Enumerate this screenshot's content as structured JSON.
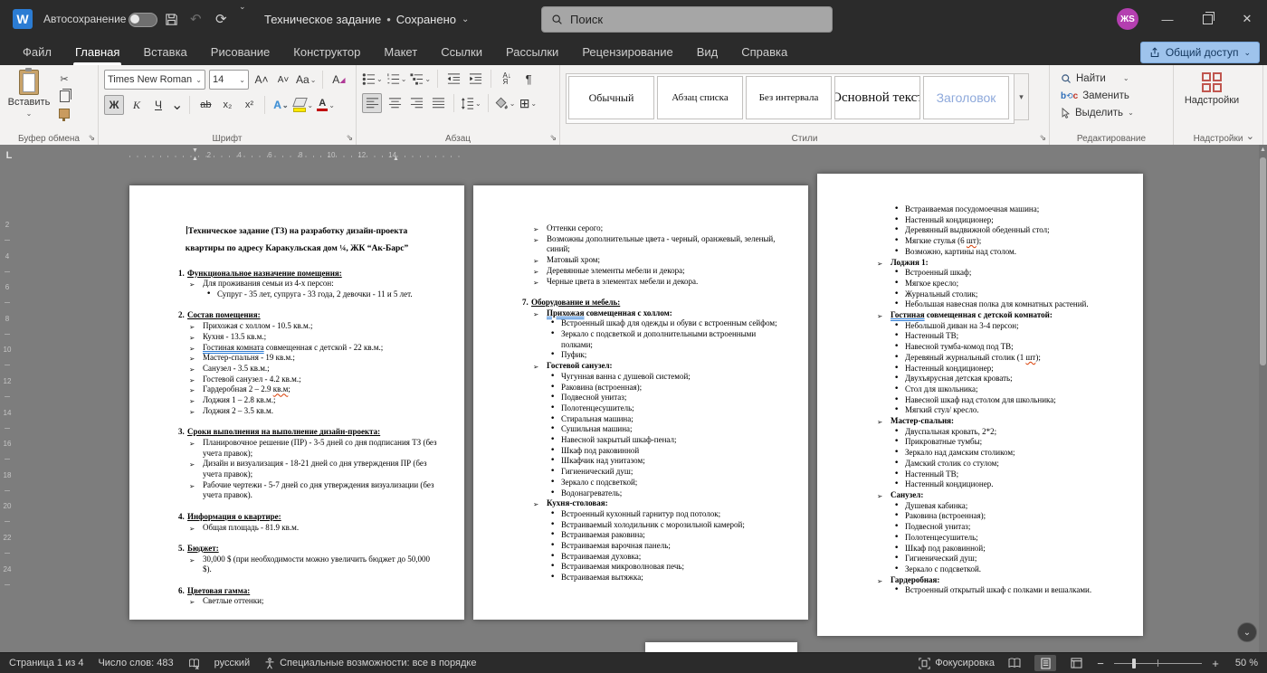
{
  "titlebar": {
    "autosave_label": "Автосохранение",
    "doc_title": "Техническое задание",
    "saved_status": "Сохранено",
    "search_placeholder": "Поиск",
    "avatar_initials": "ЖS",
    "share_label": "Общий доступ"
  },
  "icons": {
    "bullet_l1": "➢",
    "bullet_l2": "•",
    "undo": "↶",
    "redo": "⟳",
    "close": "✕",
    "minimize": "—",
    "borders": "⊞",
    "pilcrow": "¶"
  },
  "tabs": [
    {
      "id": "file",
      "label": "Файл"
    },
    {
      "id": "home",
      "label": "Главная",
      "active": true
    },
    {
      "id": "insert",
      "label": "Вставка"
    },
    {
      "id": "draw",
      "label": "Рисование"
    },
    {
      "id": "design",
      "label": "Конструктор"
    },
    {
      "id": "layout",
      "label": "Макет"
    },
    {
      "id": "references",
      "label": "Ссылки"
    },
    {
      "id": "mailings",
      "label": "Рассылки"
    },
    {
      "id": "review",
      "label": "Рецензирование"
    },
    {
      "id": "view",
      "label": "Вид"
    },
    {
      "id": "help",
      "label": "Справка"
    }
  ],
  "ribbon": {
    "clipboard": {
      "paste_label": "Вставить",
      "group_label": "Буфер обмена"
    },
    "font": {
      "font_name": "Times New Roman",
      "font_size": "14",
      "group_label": "Шрифт",
      "glyphs": {
        "bold": "Ж",
        "italic": "K",
        "underline": "Ч",
        "strikethrough": "ab",
        "subscript": "x₂",
        "superscript": "x²",
        "case": "Aa",
        "effects": "A",
        "color": "А",
        "grow": "A˄",
        "shrink": "A˅"
      }
    },
    "paragraph": {
      "group_label": "Абзац"
    },
    "styles": {
      "group_label": "Стили",
      "items": [
        {
          "id": "normal",
          "label": "Обычный"
        },
        {
          "id": "list-paragraph",
          "label": "Абзац списка"
        },
        {
          "id": "no-spacing",
          "label": "Без интервала"
        },
        {
          "id": "body-text",
          "label": "Основной текст"
        },
        {
          "id": "heading",
          "label": "Заголовок"
        }
      ]
    },
    "editing": {
      "find": "Найти",
      "replace": "Заменить",
      "select": "Выделить",
      "group_label": "Редактирование"
    },
    "addins": {
      "button_label": "Надстройки",
      "group_label": "Надстройки"
    }
  },
  "ruler": {
    "h_numbers": [
      "2",
      "4",
      "6",
      "8",
      "10",
      "12",
      "14"
    ],
    "v_numbers": [
      "2",
      "4",
      "6",
      "8",
      "10",
      "12",
      "14",
      "16",
      "18",
      "20",
      "22",
      "24"
    ]
  },
  "statusbar": {
    "page_info": "Страница 1 из 4",
    "word_count": "Число слов: 483",
    "language": "русский",
    "accessibility": "Специальные возможности: все в порядке",
    "focus_label": "Фокусировка",
    "zoom_level": "50 %"
  },
  "colors": {
    "titlebar": "#2b2b2b",
    "ribbon": "#f3f2f1",
    "canvas": "#7d7d7d",
    "accent_share": "#9ec3ec",
    "avatar": "#b43fb0",
    "addins_icon": "#c0564f",
    "heading_style": "#8ea9db",
    "spell_error": "#d83b01",
    "grammar_error": "#2d7cd6"
  },
  "pages": [
    {
      "blocks": [
        {
          "t": "title",
          "caret": true,
          "text": "Техническое задание (ТЗ) на разработку дизайн-проекта квартиры по адресу Каракульская дом ¼, ЖК “Ак-Барс”"
        },
        {
          "t": "gap"
        },
        {
          "t": "h",
          "num": "1.",
          "text": "Функциональное назначение помещения:"
        },
        {
          "t": "l1",
          "text": "Для проживания семьи из 4-х персон:"
        },
        {
          "t": "l2",
          "text": "Супруг - 35 лет, супруга - 33 года, 2 девочки - 11 и 5 лет."
        },
        {
          "t": "gap"
        },
        {
          "t": "h",
          "num": "2.",
          "text": "Состав помещения:"
        },
        {
          "t": "l1",
          "text": "Прихожая с холлом - 10.5 кв.м.;"
        },
        {
          "t": "l1",
          "text": "Кухня - 13.5 кв.м.;"
        },
        {
          "t": "l1",
          "parts": [
            {
              "x": "Гостиная комната",
              "m": "u-blue"
            },
            {
              "x": " совмещенная с детской - 22 кв.м.;"
            }
          ]
        },
        {
          "t": "l1",
          "text": "Мастер-спальня - 19 кв.м.;"
        },
        {
          "t": "l1",
          "text": "Санузел - 3.5 кв.м.;"
        },
        {
          "t": "l1",
          "text": "Гостевой санузел - 4.2 кв.м.;"
        },
        {
          "t": "l1",
          "parts": [
            {
              "x": "Гардеробная 2 – 2.9 "
            },
            {
              "x": "кв.м",
              "m": "u-red"
            },
            {
              "x": ";"
            }
          ]
        },
        {
          "t": "l1",
          "text": "Лоджия 1 – 2.8 кв.м.;"
        },
        {
          "t": "l1",
          "text": "Лоджия 2 – 3.5 кв.м."
        },
        {
          "t": "gap"
        },
        {
          "t": "h",
          "num": "3.",
          "text": "Сроки выполнения на выполнение дизайн-проекта:"
        },
        {
          "t": "l1",
          "text": "Планировочное решение (ПР) - 3-5 дней со дня подписания ТЗ (без учета правок);"
        },
        {
          "t": "l1",
          "text": "Дизайн и визуализация - 18-21 дней со дня утверждения ПР (без учета правок);"
        },
        {
          "t": "l1",
          "text": "Рабочие чертежи - 5-7 дней со дня утверждения визуализации (без учета правок)."
        },
        {
          "t": "gap"
        },
        {
          "t": "h",
          "num": "4.",
          "text": "Информация о квартире:"
        },
        {
          "t": "l1",
          "text": "Общая площадь - 81.9 кв.м."
        },
        {
          "t": "gap"
        },
        {
          "t": "h",
          "num": "5.",
          "text": "Бюджет:"
        },
        {
          "t": "l1",
          "text": "30,000 $ (при необходимости можно увеличить бюджет до 50,000 $)."
        },
        {
          "t": "gap"
        },
        {
          "t": "h",
          "num": "6.",
          "text": "Цветовая гамма:"
        },
        {
          "t": "l1",
          "text": "Светлые оттенки;"
        }
      ]
    },
    {
      "blocks": [
        {
          "t": "l1",
          "text": "Оттенки серого;"
        },
        {
          "t": "l1",
          "text": "Возможны дополнительные цвета - черный, оранжевый, зеленый, синий;"
        },
        {
          "t": "l1",
          "text": "Матовый хром;"
        },
        {
          "t": "l1",
          "text": "Деревянные элементы мебели и декора;"
        },
        {
          "t": "l1",
          "text": "Черные цвета в элементах мебели и декора."
        },
        {
          "t": "gap"
        },
        {
          "t": "h",
          "num": "7.",
          "text": "Оборудование и мебель:"
        },
        {
          "t": "l1b",
          "parts": [
            {
              "x": "Прихожая",
              "m": "u-blue"
            },
            {
              "x": " совмещенная с холлом:"
            }
          ]
        },
        {
          "t": "l2",
          "text": "Встроенный шкаф для одежды и обуви с встроенным сейфом;"
        },
        {
          "t": "l2",
          "text": "Зеркало с подсветкой и дополнительными встроенными полками;"
        },
        {
          "t": "l2",
          "text": "Пуфик;"
        },
        {
          "t": "l1b",
          "text": "Гостевой санузел:"
        },
        {
          "t": "l2",
          "text": "Чугунная ванна с душевой системой;"
        },
        {
          "t": "l2",
          "text": "Раковина (встроенная);"
        },
        {
          "t": "l2",
          "text": "Подвесной унитаз;"
        },
        {
          "t": "l2",
          "text": "Полотенцесушитель;"
        },
        {
          "t": "l2",
          "text": "Стиральная машина;"
        },
        {
          "t": "l2",
          "text": "Сушильная машина;"
        },
        {
          "t": "l2",
          "text": "Навесной закрытый шкаф-пенал;"
        },
        {
          "t": "l2",
          "text": "Шкаф под раковинной"
        },
        {
          "t": "l2",
          "text": "Шкафчик над унитазом;"
        },
        {
          "t": "l2",
          "text": "Гигиенический душ;"
        },
        {
          "t": "l2",
          "text": "Зеркало с подсветкой;"
        },
        {
          "t": "l2",
          "text": "Водонагреватель;"
        },
        {
          "t": "l1b",
          "text": "Кухня-столовая:"
        },
        {
          "t": "l2",
          "text": "Встроенный кухонный гарнитур под потолок;"
        },
        {
          "t": "l2",
          "text": "Встраиваемый холодильник с морозильной камерой;"
        },
        {
          "t": "l2",
          "text": "Встраиваемая раковина;"
        },
        {
          "t": "l2",
          "text": "Встраиваемая варочная панель;"
        },
        {
          "t": "l2",
          "text": "Встраиваемая духовка;"
        },
        {
          "t": "l2",
          "text": "Встраиваемая микроволновая печь;"
        },
        {
          "t": "l2",
          "text": "Встраиваемая вытяжка;"
        }
      ]
    },
    {
      "blocks": [
        {
          "t": "l2",
          "text": "Встраиваемая посудомоечная машина;"
        },
        {
          "t": "l2",
          "text": "Настенный кондиционер;"
        },
        {
          "t": "l2",
          "text": "Деревянный выдвижной обеденный стол;"
        },
        {
          "t": "l2",
          "parts": [
            {
              "x": "Мягкие стулья (6 "
            },
            {
              "x": "шт",
              "m": "u-red"
            },
            {
              "x": ");"
            }
          ]
        },
        {
          "t": "l2",
          "text": "Возможно, картины над столом."
        },
        {
          "t": "l1b",
          "text": "Лоджия 1:"
        },
        {
          "t": "l2",
          "text": "Встроенный шкаф;"
        },
        {
          "t": "l2",
          "text": "Мягкое кресло;"
        },
        {
          "t": "l2",
          "text": "Журнальный столик;"
        },
        {
          "t": "l2",
          "text": "Небольшая навесная полка для комнатных растений."
        },
        {
          "t": "l1b",
          "parts": [
            {
              "x": "Гостиная",
              "m": "u-blue"
            },
            {
              "x": " совмещенная с детской комнатой:"
            }
          ]
        },
        {
          "t": "l2",
          "text": "Небольшой диван на 3-4 персон;"
        },
        {
          "t": "l2",
          "text": "Настенный ТВ;"
        },
        {
          "t": "l2",
          "text": "Навесной тумба-комод под ТВ;"
        },
        {
          "t": "l2",
          "parts": [
            {
              "x": "Деревяный журнальный столик (1 "
            },
            {
              "x": "шт",
              "m": "u-red"
            },
            {
              "x": ");"
            }
          ]
        },
        {
          "t": "l2",
          "text": "Настенный кондиционер;"
        },
        {
          "t": "l2",
          "text": "Двухъярусная детская кровать;"
        },
        {
          "t": "l2",
          "text": "Стол для школьника;"
        },
        {
          "t": "l2",
          "text": "Навесной шкаф над столом для школьника;"
        },
        {
          "t": "l2",
          "text": "Мягкий стул/ кресло."
        },
        {
          "t": "l1b",
          "text": "Мастер-спальня:"
        },
        {
          "t": "l2",
          "text": "Двуспальная кровать, 2*2;"
        },
        {
          "t": "l2",
          "text": "Прикроватные тумбы;"
        },
        {
          "t": "l2",
          "text": "Зеркало над дамским столиком;"
        },
        {
          "t": "l2",
          "text": "Дамский столик со стулом;"
        },
        {
          "t": "l2",
          "text": "Настенный ТВ;"
        },
        {
          "t": "l2",
          "text": "Настенный кондиционер."
        },
        {
          "t": "l1b",
          "text": "Санузел:"
        },
        {
          "t": "l2",
          "text": "Душевая кабинка;"
        },
        {
          "t": "l2",
          "text": "Раковина (встроенная);"
        },
        {
          "t": "l2",
          "text": "Подвесной унитаз;"
        },
        {
          "t": "l2",
          "text": "Полотенцесушитель;"
        },
        {
          "t": "l2",
          "text": "Шкаф под раковинной;"
        },
        {
          "t": "l2",
          "text": "Гигиенический душ;"
        },
        {
          "t": "l2",
          "text": "Зеркало с подсветкой."
        },
        {
          "t": "l1b",
          "text": "Гардеробная:"
        },
        {
          "t": "l2",
          "text": "Встроенный открытый шкаф с полками и вешалками."
        }
      ]
    },
    {
      "blocks": []
    }
  ]
}
